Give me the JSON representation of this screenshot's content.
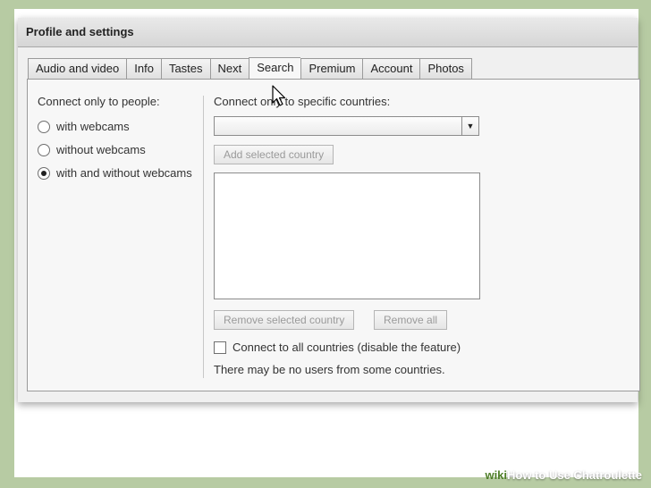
{
  "dialog": {
    "title": "Profile and settings"
  },
  "tabs": [
    {
      "label": "Audio and video"
    },
    {
      "label": "Info"
    },
    {
      "label": "Tastes"
    },
    {
      "label": "Next"
    },
    {
      "label": "Search",
      "active": true
    },
    {
      "label": "Premium"
    },
    {
      "label": "Account"
    },
    {
      "label": "Photos"
    }
  ],
  "people": {
    "heading": "Connect only to people:",
    "options": [
      {
        "label": "with webcams",
        "checked": false
      },
      {
        "label": "without webcams",
        "checked": false
      },
      {
        "label": "with and without webcams",
        "checked": true
      }
    ]
  },
  "countries": {
    "heading": "Connect only to specific countries:",
    "selected_country": "",
    "add_button": "Add selected country",
    "remove_selected_button": "Remove selected country",
    "remove_all_button": "Remove all",
    "all_countries_checkbox": "Connect to all countries (disable the feature)",
    "all_countries_checked": false,
    "note": "There may be no users from some countries."
  },
  "watermark": {
    "brand": "wiki",
    "text": "How to Use Chatroulette"
  }
}
